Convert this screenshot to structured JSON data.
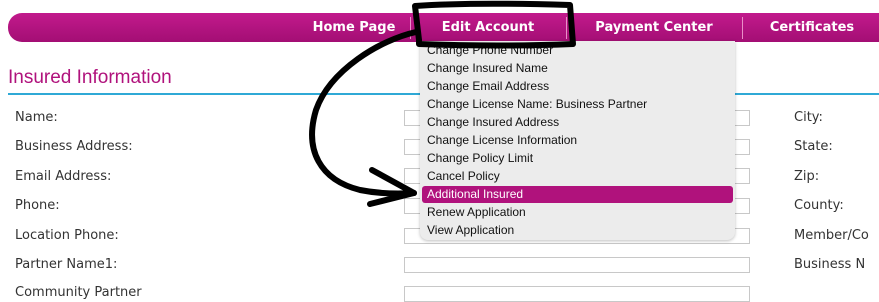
{
  "nav": {
    "items": [
      "Home Page",
      "Edit Account",
      "Payment Center",
      "Certificates"
    ]
  },
  "section_title": "Insured Information",
  "left_labels": [
    "Name:",
    "Business Address:",
    "Email Address:",
    "Phone:",
    "Location Phone:",
    "Partner Name1:",
    "Community Partner"
  ],
  "right_labels": [
    "City:",
    "State:",
    "Zip:",
    "County:",
    "Member/Co",
    "Business N"
  ],
  "dropdown": {
    "items": [
      "Change Phone Number",
      "Change Insured Name",
      "Change Email Address",
      "Change License Name: Business Partner",
      "Change Insured Address",
      "Change License Information",
      "Change Policy Limit",
      "Cancel Policy",
      "Additional Insured",
      "Renew Application",
      "View Application"
    ],
    "highlighted": "Additional Insured"
  },
  "colors": {
    "brand_magenta": "#b0127c",
    "accent_blue": "#2fa9d6",
    "annotation_black": "#000000"
  }
}
